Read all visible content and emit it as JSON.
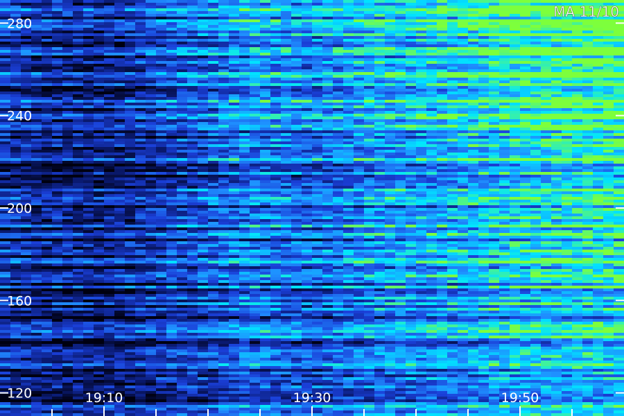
{
  "chart_data": {
    "type": "heatmap",
    "title": "MA 11/10",
    "xlabel": "",
    "ylabel": "",
    "x_ticks": [
      "19:10",
      "19:30",
      "19:50"
    ],
    "y_ticks": [
      280,
      240,
      200,
      160,
      120
    ],
    "ylim": [
      110,
      290
    ],
    "x_range_minutes": [
      "19:00",
      "20:00"
    ],
    "grid": false,
    "colorscale": [
      "#000010",
      "#0a1a70",
      "#1a3fd8",
      "#1f8fff",
      "#00e5ff",
      "#7dff3c"
    ],
    "intensity_by_time": [
      {
        "time": "19:00",
        "level": 0.3
      },
      {
        "time": "19:05",
        "level": 0.22
      },
      {
        "time": "19:10",
        "level": 0.18
      },
      {
        "time": "19:15",
        "level": 0.33
      },
      {
        "time": "19:20",
        "level": 0.45
      },
      {
        "time": "19:25",
        "level": 0.58
      },
      {
        "time": "19:30",
        "level": 0.5
      },
      {
        "time": "19:35",
        "level": 0.62
      },
      {
        "time": "19:40",
        "level": 0.68
      },
      {
        "time": "19:45",
        "level": 0.75
      },
      {
        "time": "19:50",
        "level": 0.85
      },
      {
        "time": "19:55",
        "level": 0.9
      },
      {
        "time": "20:00",
        "level": 0.92
      }
    ]
  }
}
